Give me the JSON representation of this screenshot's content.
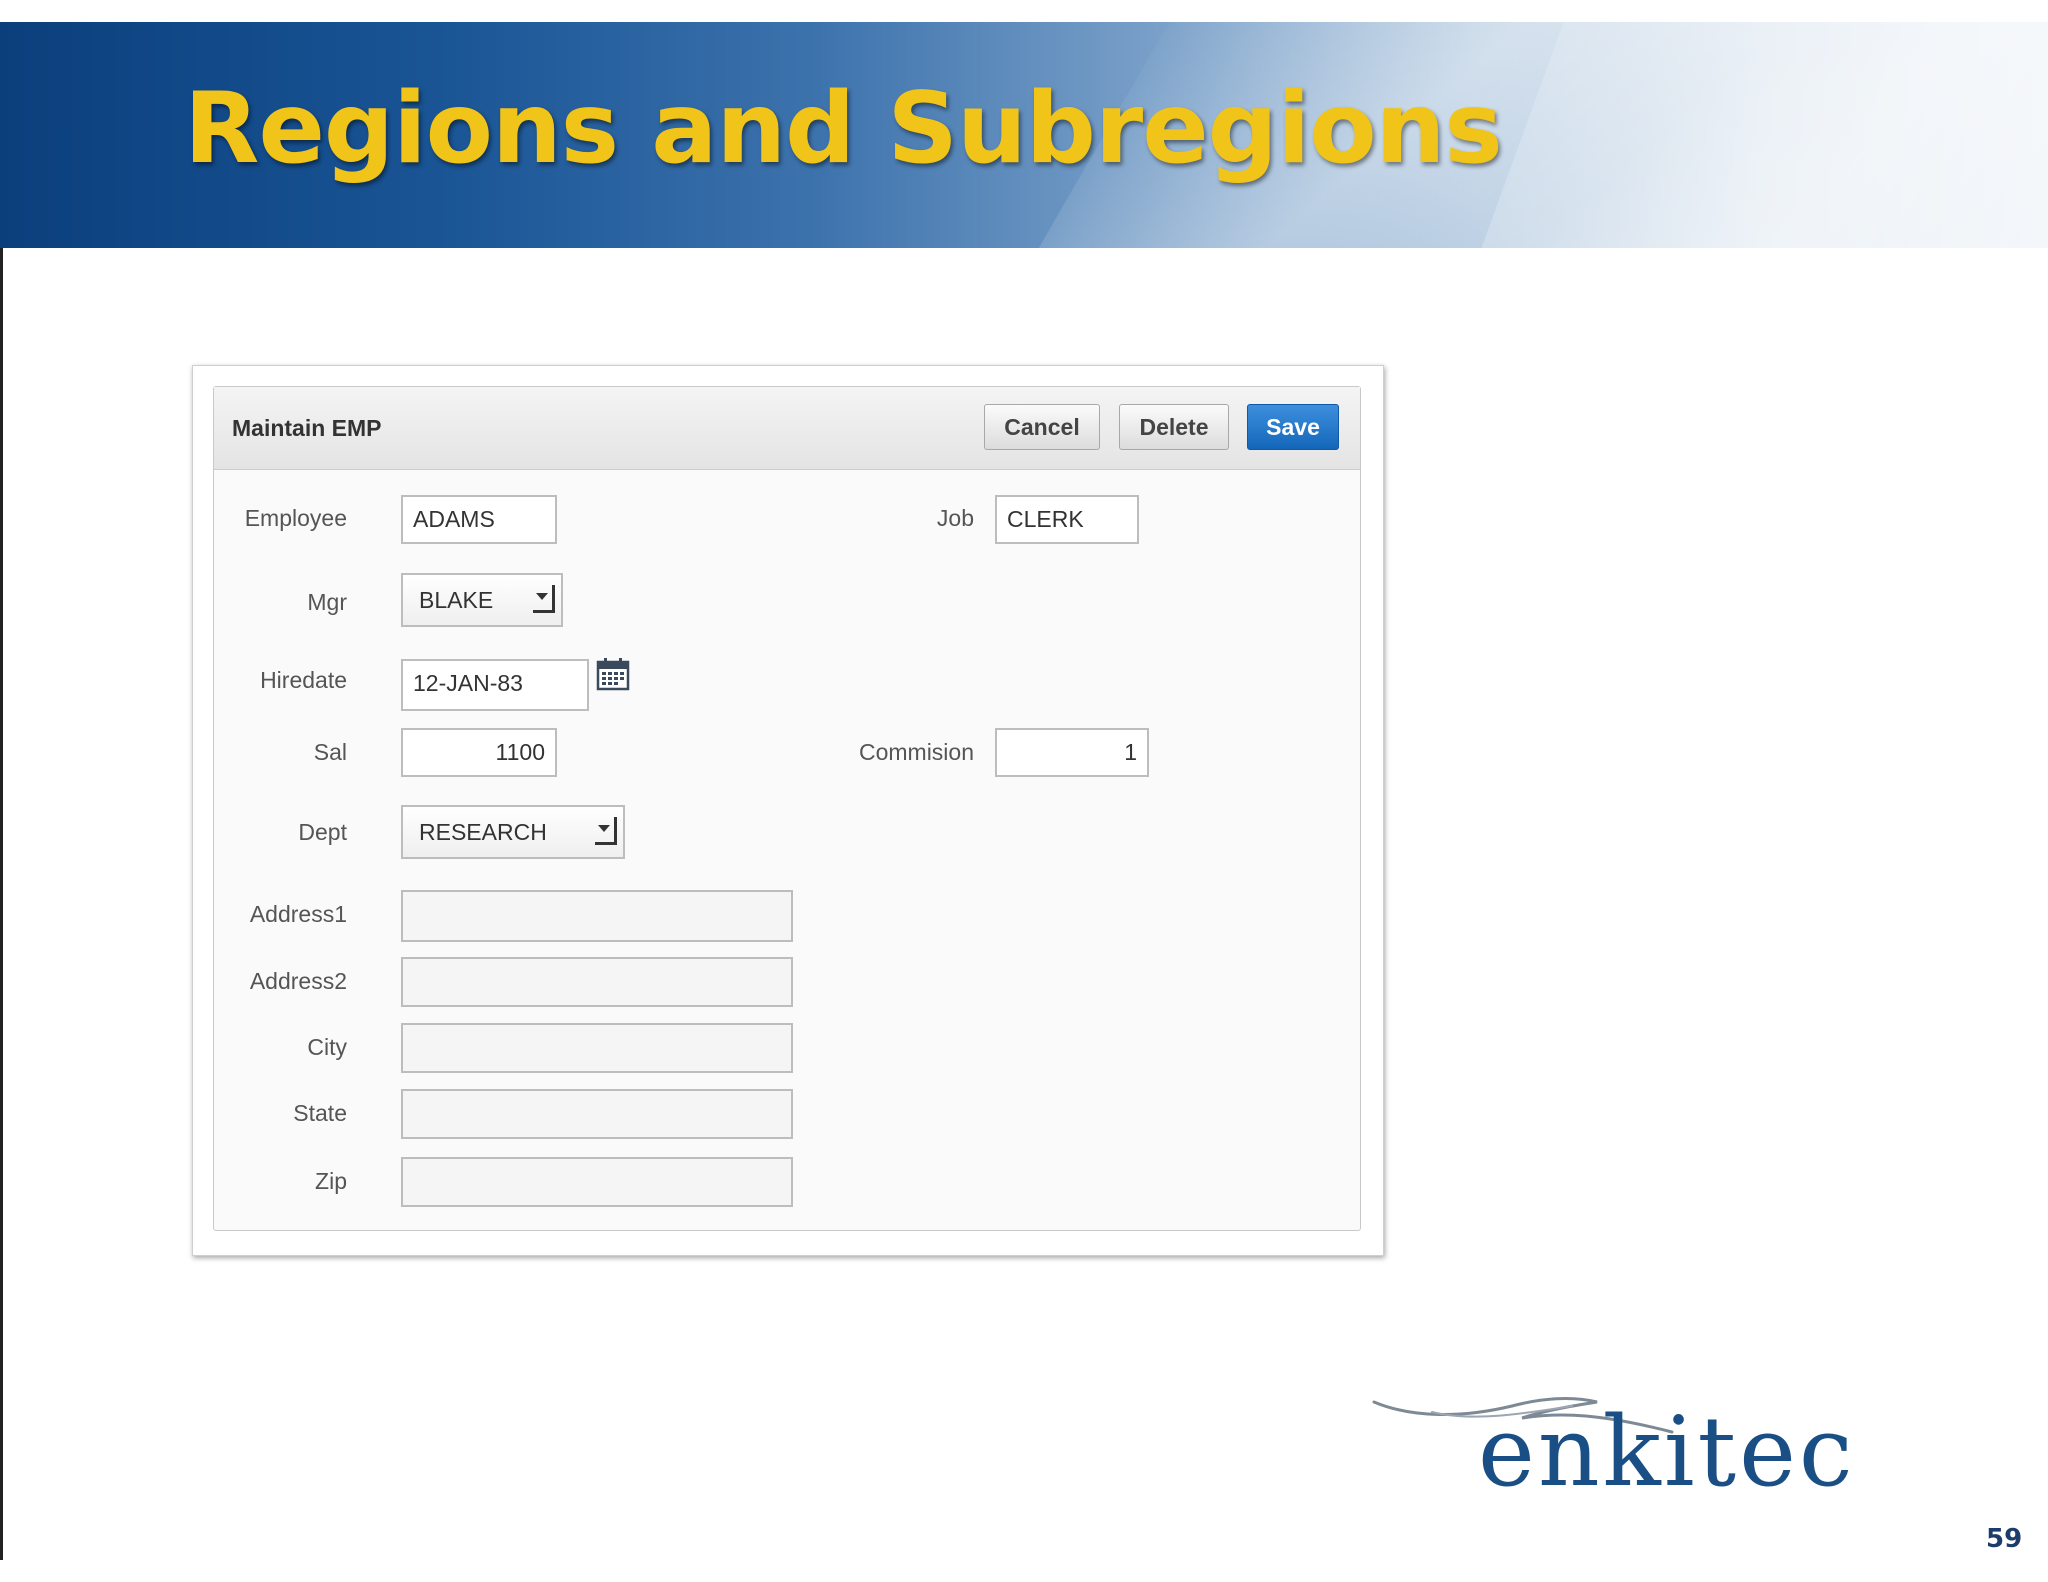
{
  "slide": {
    "title": "Regions and Subregions",
    "page_number": "59",
    "logo_text": "enkitec"
  },
  "region": {
    "title": "Maintain EMP",
    "buttons": {
      "cancel": "Cancel",
      "delete": "Delete",
      "save": "Save"
    }
  },
  "form": {
    "employee": {
      "label": "Employee",
      "value": "ADAMS"
    },
    "job": {
      "label": "Job",
      "value": "CLERK"
    },
    "mgr": {
      "label": "Mgr",
      "value": "BLAKE"
    },
    "hiredate": {
      "label": "Hiredate",
      "value": "12-JAN-83",
      "icon": "calendar-icon"
    },
    "sal": {
      "label": "Sal",
      "value": "1100"
    },
    "commision": {
      "label": "Commision",
      "value": "1"
    },
    "dept": {
      "label": "Dept",
      "value": "RESEARCH"
    },
    "address1": {
      "label": "Address1",
      "value": ""
    },
    "address2": {
      "label": "Address2",
      "value": ""
    },
    "city": {
      "label": "City",
      "value": ""
    },
    "state": {
      "label": "State",
      "value": ""
    },
    "zip": {
      "label": "Zip",
      "value": ""
    }
  },
  "colors": {
    "title_gold": "#f0c419",
    "banner_blue": "#0b3f7c",
    "save_blue": "#1466b9"
  }
}
